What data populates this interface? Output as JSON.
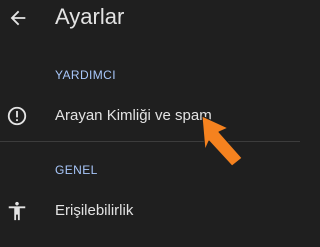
{
  "app_bar": {
    "title": "Ayarlar",
    "back_icon": "arrow-back-icon"
  },
  "sections": [
    {
      "header": "YARDIMCI",
      "items": [
        {
          "label": "Arayan Kimliği ve spam",
          "icon": "info-outline-icon"
        }
      ]
    },
    {
      "header": "GENEL",
      "items": [
        {
          "label": "Erişilebilirlik",
          "icon": "accessibility-icon"
        }
      ]
    }
  ],
  "colors": {
    "background": "#1f1f1f",
    "text": "#e3e3e3",
    "section_header": "#a8c7fa",
    "divider": "#3c3c3c",
    "annotation_arrow": "#f5821f"
  },
  "annotation": {
    "icon": "orange-arrow-pointer"
  }
}
